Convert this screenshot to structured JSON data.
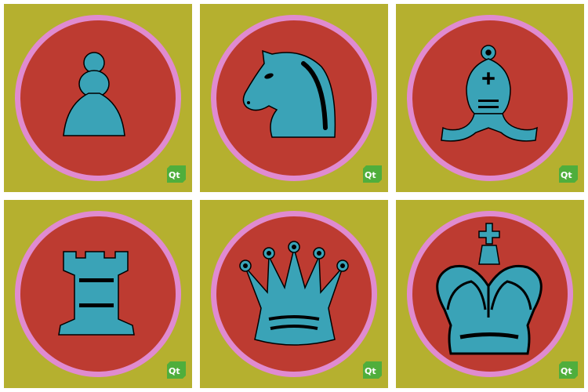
{
  "colors": {
    "tile_background": "#b5b02f",
    "circle_fill": "#bd3b31",
    "circle_ring": "#e08bd0",
    "piece_fill": "#3aa3b7",
    "piece_outline": "#000000",
    "logo_fill": "#4fae3c",
    "logo_text": "#ffffff"
  },
  "tiles": [
    {
      "piece": "pawn",
      "logo": "Qt"
    },
    {
      "piece": "knight",
      "logo": "Qt"
    },
    {
      "piece": "bishop",
      "logo": "Qt"
    },
    {
      "piece": "rook",
      "logo": "Qt"
    },
    {
      "piece": "queen",
      "logo": "Qt"
    },
    {
      "piece": "king",
      "logo": "Qt"
    }
  ]
}
